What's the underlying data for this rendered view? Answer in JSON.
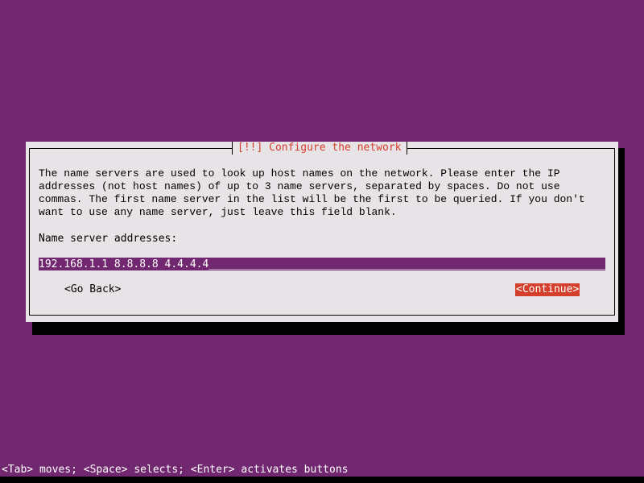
{
  "dialog": {
    "title": "[!!] Configure the network",
    "message": "The name servers are used to look up host names on the network. Please enter the IP\naddresses (not host names) of up to 3 name servers, separated by spaces. Do not use\ncommas. The first name server in the list will be the first to be queried. If you don't\nwant to use any name server, just leave this field blank.",
    "field_label": "Name server addresses:",
    "field_value": "192.168.1.1 8.8.8.8 4.4.4.4",
    "field_fill": "___________________________________________________________________________________________",
    "buttons": {
      "go_back": "<Go Back>",
      "continue": "<Continue>"
    }
  },
  "status_bar": {
    "text": "<Tab> moves; <Space> selects; <Enter> activates buttons"
  },
  "colors": {
    "background": "#722870",
    "dialog_bg": "#e8e3e6",
    "accent_red": "#d43f2c",
    "field_bg": "#722870"
  }
}
